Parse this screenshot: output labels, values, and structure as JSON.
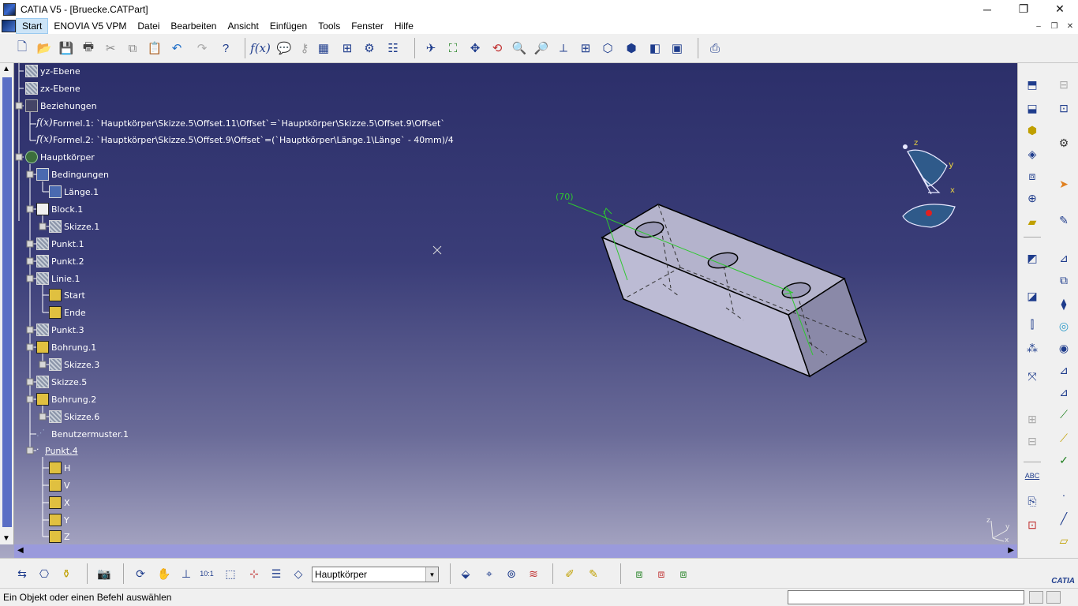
{
  "window": {
    "title": "CATIA V5 - [Bruecke.CATPart]",
    "minimize": "─",
    "restore": "❐",
    "close": "✕"
  },
  "menu": {
    "items": [
      "Start",
      "ENOVIA V5 VPM",
      "Datei",
      "Bearbeiten",
      "Ansicht",
      "Einfügen",
      "Tools",
      "Fenster",
      "Hilfe"
    ],
    "active_index": 0,
    "mdi_minimize": "–",
    "mdi_restore": "❐",
    "mdi_close": "✕"
  },
  "tree": {
    "nodes": [
      {
        "label": "yz-Ebene",
        "icon": "plane-icon"
      },
      {
        "label": "zx-Ebene",
        "icon": "plane-icon"
      },
      {
        "label": "Beziehungen",
        "icon": "relations-icon"
      },
      {
        "label": "Formel.1: `Hauptkörper\\Skizze.5\\Offset.11\\Offset`=`Hauptkörper\\Skizze.5\\Offset.9\\Offset`",
        "icon": "formula-icon"
      },
      {
        "label": "Formel.2: `Hauptkörper\\Skizze.5\\Offset.9\\Offset`=(`Hauptkörper\\Länge.1\\Länge` - 40mm)/4",
        "icon": "formula-icon"
      },
      {
        "label": "Hauptkörper",
        "icon": "body-icon"
      },
      {
        "label": "Bedingungen",
        "icon": "constraints-icon"
      },
      {
        "label": "Länge.1",
        "icon": "constraint-icon"
      },
      {
        "label": "Block.1",
        "icon": "pad-icon"
      },
      {
        "label": "Skizze.1",
        "icon": "sketch-icon"
      },
      {
        "label": "Punkt.1",
        "icon": "point-icon"
      },
      {
        "label": "Punkt.2",
        "icon": "point-icon"
      },
      {
        "label": "Linie.1",
        "icon": "line-icon"
      },
      {
        "label": "Start",
        "icon": "parameter-icon"
      },
      {
        "label": "Ende",
        "icon": "parameter-icon"
      },
      {
        "label": "Punkt.3",
        "icon": "point-icon"
      },
      {
        "label": "Bohrung.1",
        "icon": "hole-icon"
      },
      {
        "label": "Skizze.3",
        "icon": "sketch-icon"
      },
      {
        "label": "Skizze.5",
        "icon": "sketch-icon"
      },
      {
        "label": "Bohrung.2",
        "icon": "hole-icon"
      },
      {
        "label": "Skizze.6",
        "icon": "sketch-icon"
      },
      {
        "label": "Benutzermuster.1",
        "icon": "pattern-icon"
      },
      {
        "label": "Punkt.4",
        "icon": "point-small-icon"
      },
      {
        "label": "H",
        "icon": "parameter-icon"
      },
      {
        "label": "V",
        "icon": "parameter-icon"
      },
      {
        "label": "X",
        "icon": "parameter-icon"
      },
      {
        "label": "Y",
        "icon": "parameter-icon"
      },
      {
        "label": "Z",
        "icon": "parameter-icon"
      }
    ]
  },
  "viewport": {
    "dimension_label": "(70)",
    "compass_axes": {
      "x": "x",
      "y": "y",
      "z": "z"
    },
    "mini_axes": {
      "x": "x",
      "y": "y",
      "z": "z"
    }
  },
  "bottom_toolbar": {
    "current_body": "Hauptkörper"
  },
  "status": {
    "message": "Ein Objekt oder einen Befehl auswählen"
  },
  "logo": "CATIA",
  "colors": {
    "viewport_top": "#2c2f6a",
    "viewport_bottom": "#a9a8c4",
    "dimension_green": "#2ec82e",
    "part_face": "#b9b8d0"
  }
}
